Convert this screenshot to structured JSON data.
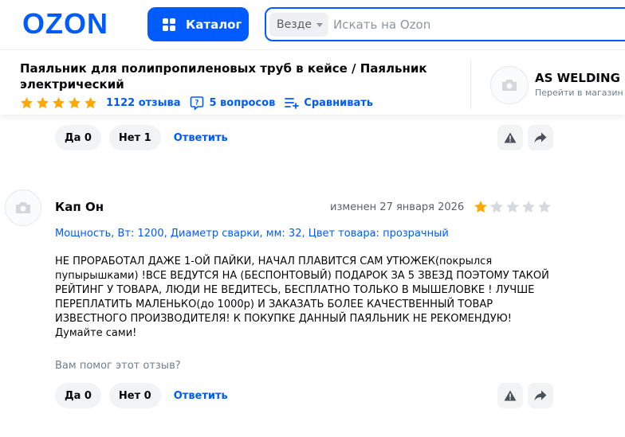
{
  "header": {
    "logo": "OZON",
    "catalog_label": "Каталог",
    "search_scope": "Везде",
    "search_placeholder": "Искать на Ozon"
  },
  "product": {
    "title": "Паяльник для полипропиленовых труб в кейсе / Паяльник электрический",
    "rating_stars": 5,
    "reviews_link": "1122 отзыва",
    "questions_link": "5 вопросов",
    "compare_link": "Сравнивать"
  },
  "seller": {
    "name": "AS WELDING",
    "link": "Перейти в магазин"
  },
  "prev_review": {
    "yes_label": "Да 0",
    "no_label": "Нет 1",
    "reply_label": "Ответить"
  },
  "review": {
    "author": "Кап Он",
    "date": "изменен 27 января 2026",
    "rating": 1,
    "rating_max": 5,
    "variant": "Мощность, Вт: 1200, Диаметр сварки, мм: 32, Цвет товара: прозрачный",
    "text": "НЕ ПРОРАБОТАЛ ДАЖЕ 1-ОЙ ПАЙКИ, НАЧАЛ ПЛАВИТСЯ САМ УТЮЖЕК(покрылся пупырышками) !ВСЕ ВЕДУТСЯ НА (БЕСПОНТОВЫЙ) ПОДАРОК ЗА 5 ЗВЕЗД ПОЭТОМУ ТАКОЙ РЕЙТИНГ У ТОВАРА, ЛЮДИ НЕ ВЕДИТЕСЬ, БЕСПЛАТНО ТОЛЬКО В МЫШЕЛОВКЕ ! ЛУЧШЕ ПЕРЕПЛАТИТЬ МАЛЕНЬКО(до 1000р) И ЗАКАЗАТЬ БОЛЕЕ КАЧЕСТВЕННЫЙ ТОВАР ИЗВЕСТНОГО ПРОИЗВОДИТЕЛЯ! К ПОКУПКЕ ДАННЫЙ ПАЯЛЬНИК НЕ РЕКОМЕНДУЮ! Думайте сами!",
    "helpful_question": "Вам помог этот отзыв?",
    "yes_label": "Да 0",
    "no_label": "Нет 0",
    "reply_label": "Ответить"
  },
  "colors": {
    "brand": "#005bff",
    "star_filled": "#ffa800",
    "star_empty": "#d6d9dd"
  }
}
